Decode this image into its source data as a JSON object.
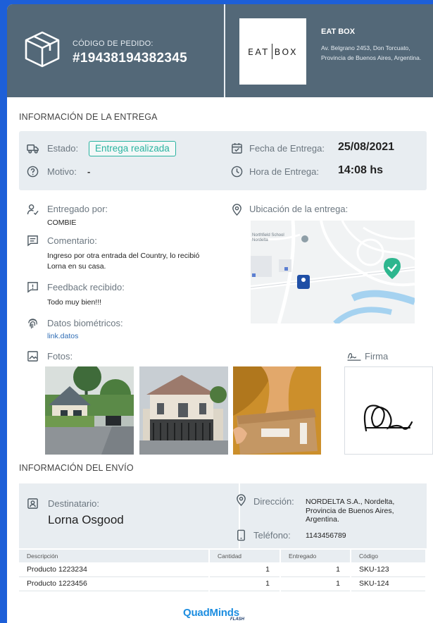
{
  "header": {
    "order_code_label": "CÓDIGO DE PEDIDO:",
    "order_code": "#19438194382345",
    "brand_logo_text_left": "EAT",
    "brand_logo_text_right": "BOX",
    "business_name": "EAT BOX",
    "business_address": "Av. Belgrano 2453, Don Torcuato, Provincia de Buenos Aires, Argentina."
  },
  "delivery": {
    "section_title": "INFORMACIÓN DE LA ENTREGA",
    "status_label": "Estado:",
    "status_value": "Entrega realizada",
    "reason_label": "Motivo:",
    "reason_value": "-",
    "date_label": "Fecha de Entrega:",
    "date_value": "25/08/2021",
    "time_label": "Hora de Entrega:",
    "time_value": "14:08 hs",
    "delivered_by_label": "Entregado por:",
    "delivered_by_value": "COMBIE",
    "comment_label": "Comentario:",
    "comment_value": "Ingreso por otra entrada del Country, lo recibió Lorna en su casa.",
    "feedback_label": "Feedback recibido:",
    "feedback_value": "Todo muy bien!!!",
    "biometric_label": "Datos biométricos:",
    "biometric_link": "link.datos",
    "location_label": "Ubicación de la entrega:",
    "map_poi": "Northfield School Nordelta",
    "photos_label": "Fotos:",
    "signature_label": "Firma"
  },
  "shipping": {
    "section_title": "INFORMACIÓN DEL ENVÍO",
    "recipient_label": "Destinatario:",
    "recipient_value": "Lorna Osgood",
    "address_label": "Dirección:",
    "address_value": "NORDELTA S.A., Nordelta, Provincia de Buenos Aires, Argentina.",
    "phone_label": "Teléfono:",
    "phone_value": "1143456789",
    "columns": [
      "Descripción",
      "Cantidad",
      "Entregado",
      "Código"
    ],
    "rows": [
      [
        "Producto 1223234",
        "1",
        "1",
        "SKU-123"
      ],
      [
        "Producto 1223456",
        "1",
        "1",
        "SKU-124"
      ]
    ]
  },
  "footer": {
    "brand": "QuadMinds",
    "brand_sub": "FLASH"
  },
  "colors": {
    "header_bg": "#536878",
    "panel_bg": "#e8edf1",
    "status_accent": "#2ab3a0",
    "link": "#2f6db5",
    "page_bg": "#1d5fd8"
  }
}
